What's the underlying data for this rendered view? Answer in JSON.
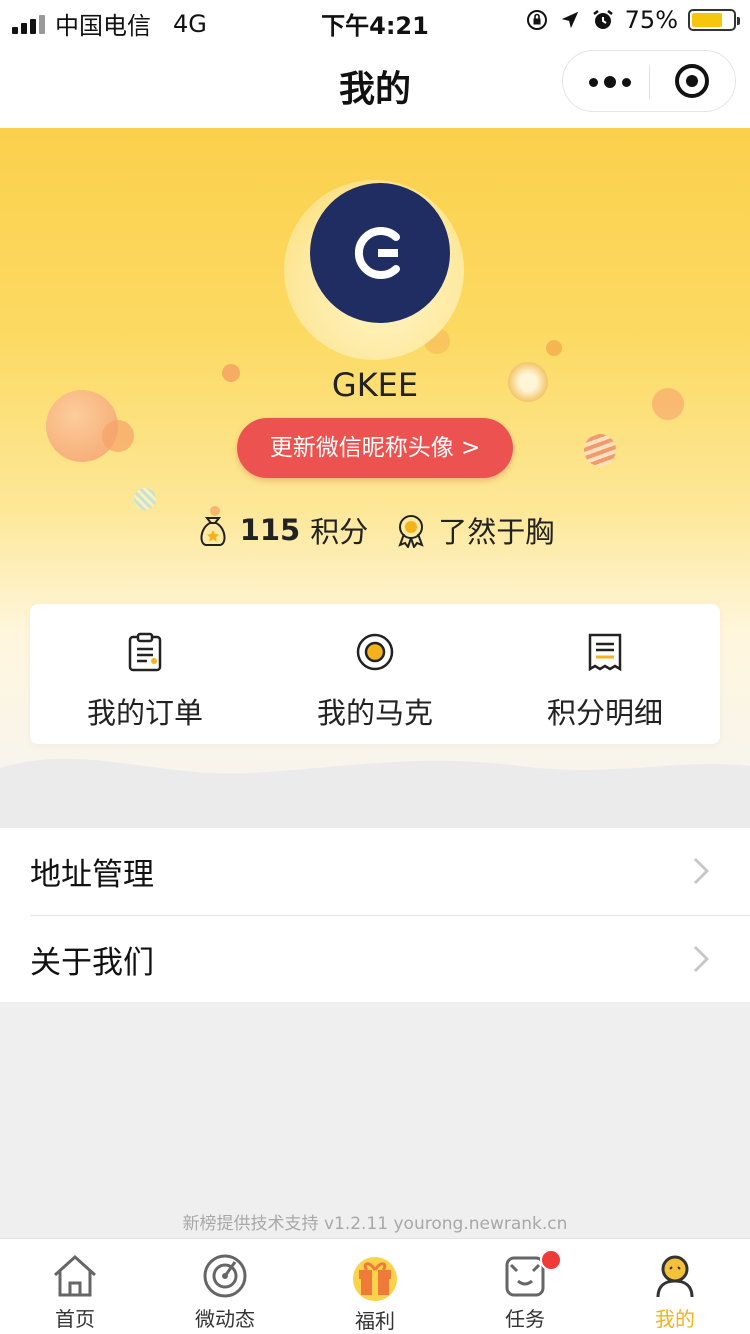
{
  "status_bar": {
    "carrier": "中国电信",
    "network": "4G",
    "time": "下午4:21",
    "battery": "75%"
  },
  "nav": {
    "title": "我的"
  },
  "profile": {
    "username": "GKEE",
    "update_button": "更新微信昵称头像 >",
    "points_value": "115",
    "points_unit": "积分",
    "level": "了然于胸"
  },
  "quick_actions": [
    {
      "label": "我的订单",
      "icon": "clipboard-icon"
    },
    {
      "label": "我的马克",
      "icon": "coin-icon"
    },
    {
      "label": "积分明细",
      "icon": "receipt-icon"
    }
  ],
  "menu": [
    {
      "label": "地址管理"
    },
    {
      "label": "关于我们"
    }
  ],
  "footer": "新榜提供技术支持 v1.2.11  yourong.newrank.cn",
  "tabs": [
    {
      "label": "首页",
      "icon": "home-icon"
    },
    {
      "label": "微动态",
      "icon": "radar-icon"
    },
    {
      "label": "福利",
      "icon": "gift-icon"
    },
    {
      "label": "任务",
      "icon": "task-icon"
    },
    {
      "label": "我的",
      "icon": "user-icon"
    }
  ],
  "colors": {
    "accent": "#f4b21d",
    "update_button": "#ec5350",
    "avatar_bg": "#1f2d63",
    "badge": "#ef3a3a"
  }
}
